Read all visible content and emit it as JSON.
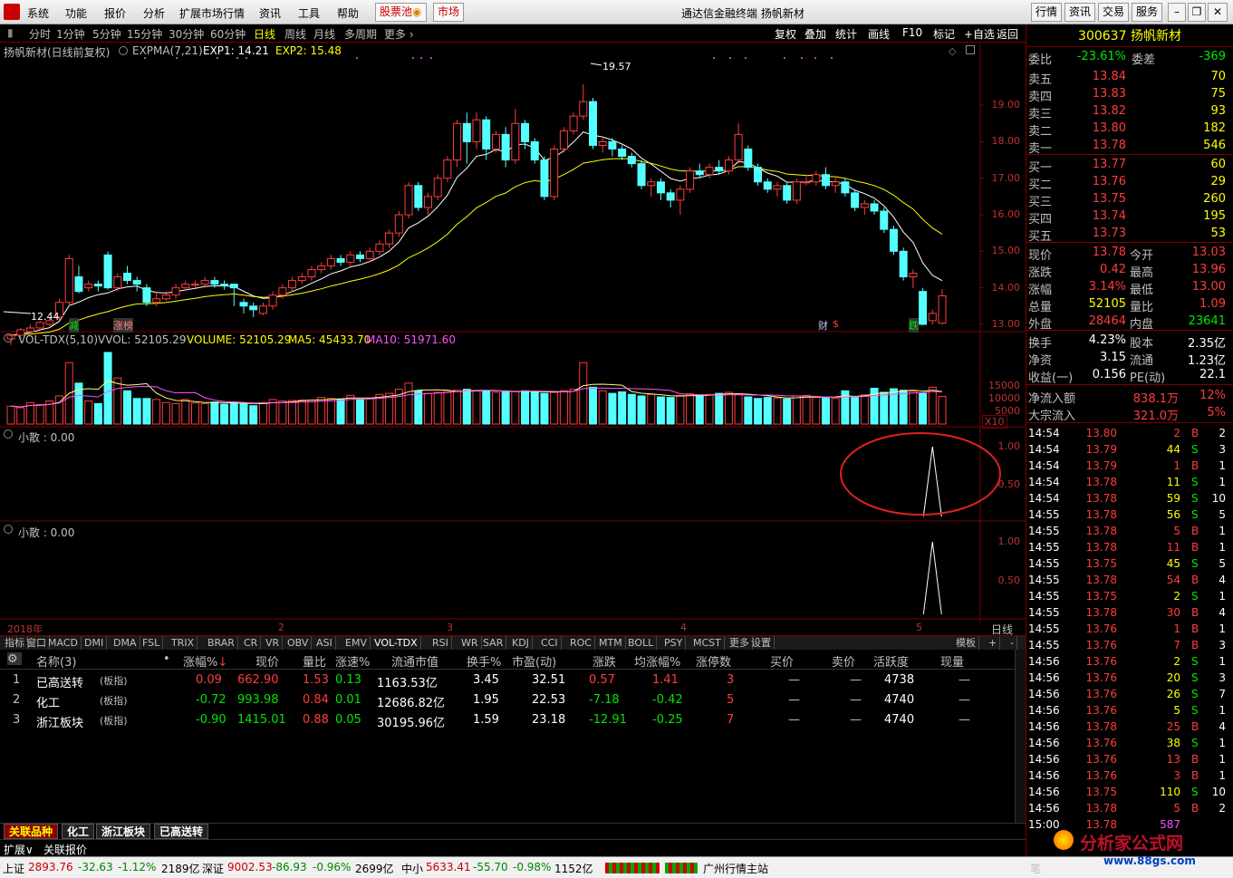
{
  "menu": {
    "items": [
      "系统",
      "功能",
      "报价",
      "分析",
      "扩展市场行情",
      "资讯",
      "工具",
      "帮助"
    ],
    "gupiaochi": "股票池",
    "shichang": "市场",
    "title": "通达信金融终端  扬帆新材",
    "right_btns": [
      "行情",
      "资讯",
      "交易",
      "服务"
    ]
  },
  "periods": {
    "items": [
      "分时",
      "1分钟",
      "5分钟",
      "15分钟",
      "30分钟",
      "60分钟",
      "日线",
      "周线",
      "月线",
      "多周期",
      "更多"
    ],
    "active": "日线"
  },
  "tools": [
    "复权",
    "叠加",
    "统计",
    "画线",
    "F10",
    "标记",
    "+自选",
    "返回"
  ],
  "chart_header": {
    "name": "扬帆新材(日线前复权)",
    "ind": "EXPMA(7,21)",
    "exp1": "EXP1: 14.21",
    "exp2": "EXP2: 15.48"
  },
  "price_axis": [
    "19.00",
    "18.00",
    "17.00",
    "16.00",
    "15.00",
    "14.00",
    "13.00"
  ],
  "annotations": {
    "high": "19.57",
    "low": "12.44",
    "tags": [
      "减",
      "涨榜",
      "财",
      "跌"
    ]
  },
  "vol_header": {
    "name": "VOL-TDX(5,10)",
    "vvol": "VVOL: 52105.29",
    "volume": "VOLUME: 52105.29",
    "ma5": "MA5: 45433.70",
    "ma10": "MA10: 51971.60"
  },
  "vol_axis": [
    "15000",
    "10000",
    "5000"
  ],
  "vol_unit": "X10",
  "sub1": {
    "title": "小散 : 0.00",
    "axis": [
      "1.00",
      "0.50"
    ]
  },
  "sub2": {
    "title": "小散 : 0.00",
    "axis": [
      "1.00",
      "0.50"
    ]
  },
  "time_axis": {
    "labels": [
      "2018年",
      "2",
      "3",
      "4",
      "5"
    ],
    "period": "日线"
  },
  "ind_tabs": [
    "指标",
    "窗口",
    "MACD",
    "DMI",
    "DMA",
    "FSL",
    "TRIX",
    "BRAR",
    "CR",
    "VR",
    "OBV",
    "ASI",
    "EMV",
    "VOL-TDX",
    "RSI",
    "WR",
    "SAR",
    "KDJ",
    "CCI",
    "ROC",
    "MTM",
    "BOLL",
    "PSY",
    "MCST",
    "更多",
    "设置"
  ],
  "ind_tabs_right": [
    "模板",
    "+",
    "-"
  ],
  "table": {
    "headers": [
      "名称(3)",
      "•",
      "涨幅%",
      "现价",
      "量比",
      "涨速%",
      "流通市值",
      "换手%",
      "市盈(动)",
      "涨跌",
      "均涨幅%",
      "涨停数",
      "买价",
      "卖价",
      "活跃度",
      "现量"
    ],
    "rows": [
      {
        "idx": "1",
        "name": "已高送转",
        "type": "(板指)",
        "chg": "0.09",
        "price": "662.90",
        "lb": "1.53",
        "speed": "0.13",
        "mv": "1163.53亿",
        "hs": "3.45",
        "pe": "32.51",
        "zd": "0.57",
        "avg": "1.41",
        "zt": "3",
        "buy": "—",
        "sell": "—",
        "act": "4738",
        "cur": "—"
      },
      {
        "idx": "2",
        "name": "化工",
        "type": "(板指)",
        "chg": "-0.72",
        "price": "993.98",
        "lb": "0.84",
        "speed": "0.01",
        "mv": "12686.82亿",
        "hs": "1.95",
        "pe": "22.53",
        "zd": "-7.18",
        "avg": "-0.42",
        "zt": "5",
        "buy": "—",
        "sell": "—",
        "act": "4740",
        "cur": "—"
      },
      {
        "idx": "3",
        "name": "浙江板块",
        "type": "(板指)",
        "chg": "-0.90",
        "price": "1415.01",
        "lb": "0.88",
        "speed": "0.05",
        "mv": "30195.96亿",
        "hs": "1.59",
        "pe": "23.18",
        "zd": "-12.91",
        "avg": "-0.25",
        "zt": "7",
        "buy": "—",
        "sell": "—",
        "act": "4740",
        "cur": "—"
      }
    ]
  },
  "bottom_tabs": [
    "关联品种",
    "化工",
    "浙江板块",
    "已高送转"
  ],
  "ext_tabs": [
    "扩展∨",
    "关联报价"
  ],
  "quote": {
    "code_name": "300637 扬帆新材",
    "weibi_label": "委比",
    "weibi": "-23.61%",
    "weicha_label": "委差",
    "weicha": "-369",
    "sells": [
      {
        "l": "卖五",
        "p": "13.84",
        "v": "70"
      },
      {
        "l": "卖四",
        "p": "13.83",
        "v": "75"
      },
      {
        "l": "卖三",
        "p": "13.82",
        "v": "93"
      },
      {
        "l": "卖二",
        "p": "13.80",
        "v": "182"
      },
      {
        "l": "卖一",
        "p": "13.78",
        "v": "546"
      }
    ],
    "buys": [
      {
        "l": "买一",
        "p": "13.77",
        "v": "60"
      },
      {
        "l": "买二",
        "p": "13.76",
        "v": "29"
      },
      {
        "l": "买三",
        "p": "13.75",
        "v": "260"
      },
      {
        "l": "买四",
        "p": "13.74",
        "v": "195"
      },
      {
        "l": "买五",
        "p": "13.73",
        "v": "53"
      }
    ],
    "stats": [
      {
        "a": "现价",
        "av": "13.78",
        "b": "今开",
        "bv": "13.03"
      },
      {
        "a": "涨跌",
        "av": "0.42",
        "b": "最高",
        "bv": "13.96"
      },
      {
        "a": "涨幅",
        "av": "3.14%",
        "b": "最低",
        "bv": "13.00"
      },
      {
        "a": "总量",
        "av": "52105",
        "b": "量比",
        "bv": "1.09"
      },
      {
        "a": "外盘",
        "av": "28464",
        "b": "内盘",
        "bv": "23641"
      }
    ],
    "stats2": [
      {
        "a": "换手",
        "av": "4.23%",
        "b": "股本",
        "bv": "2.35亿"
      },
      {
        "a": "净资",
        "av": "3.15",
        "b": "流通",
        "bv": "1.23亿"
      },
      {
        "a": "收益(一)",
        "av": "0.156",
        "b": "PE(动)",
        "bv": "22.1"
      }
    ],
    "flows": [
      {
        "l": "净流入额",
        "v": "838.1万",
        "p": "12%"
      },
      {
        "l": "大宗流入",
        "v": "321.0万",
        "p": "5%"
      }
    ]
  },
  "ticks": [
    [
      "14:54",
      "13.80",
      "2",
      "B",
      "2"
    ],
    [
      "14:54",
      "13.79",
      "44",
      "S",
      "3"
    ],
    [
      "14:54",
      "13.79",
      "1",
      "B",
      "1"
    ],
    [
      "14:54",
      "13.78",
      "11",
      "S",
      "1"
    ],
    [
      "14:54",
      "13.78",
      "59",
      "S",
      "10"
    ],
    [
      "14:55",
      "13.78",
      "56",
      "S",
      "5"
    ],
    [
      "14:55",
      "13.78",
      "5",
      "B",
      "1"
    ],
    [
      "14:55",
      "13.78",
      "11",
      "B",
      "1"
    ],
    [
      "14:55",
      "13.75",
      "45",
      "S",
      "5"
    ],
    [
      "14:55",
      "13.78",
      "54",
      "B",
      "4"
    ],
    [
      "14:55",
      "13.75",
      "2",
      "S",
      "1"
    ],
    [
      "14:55",
      "13.78",
      "30",
      "B",
      "4"
    ],
    [
      "14:55",
      "13.76",
      "1",
      "B",
      "1"
    ],
    [
      "14:55",
      "13.76",
      "7",
      "B",
      "3"
    ],
    [
      "14:56",
      "13.76",
      "2",
      "S",
      "1"
    ],
    [
      "14:56",
      "13.76",
      "20",
      "S",
      "3"
    ],
    [
      "14:56",
      "13.76",
      "26",
      "S",
      "7"
    ],
    [
      "14:56",
      "13.76",
      "5",
      "S",
      "1"
    ],
    [
      "14:56",
      "13.78",
      "25",
      "B",
      "4"
    ],
    [
      "14:56",
      "13.76",
      "38",
      "S",
      "1"
    ],
    [
      "14:56",
      "13.76",
      "13",
      "B",
      "1"
    ],
    [
      "14:56",
      "13.76",
      "3",
      "B",
      "1"
    ],
    [
      "14:56",
      "13.75",
      "110",
      "S",
      "10"
    ],
    [
      "14:56",
      "13.78",
      "5",
      "B",
      "2"
    ],
    [
      "15:00",
      "13.78",
      "587",
      "",
      ""
    ]
  ],
  "status": {
    "sh_label": "上证",
    "sh": "2893.76",
    "sh_chg": "-32.63",
    "sh_pct": "-1.12%",
    "sh_amt": "2189亿",
    "sz_label": "深证",
    "sz": "9002.53",
    "sz_chg": "-86.93",
    "sz_pct": "-0.96%",
    "sz_amt": "2699亿",
    "zx_label": "中小",
    "zx": "5633.41",
    "zx_chg": "-55.70",
    "zx_pct": "-0.98%",
    "zx_amt": "1152亿",
    "server": "广州行情主站",
    "watermark": "分析家公式网",
    "watermark_url": "www.88gs.com",
    "bi": "笔"
  },
  "candles": [
    [
      12.6,
      12.7,
      12.44,
      12.75
    ],
    [
      12.7,
      12.85,
      12.6,
      12.9
    ],
    [
      12.8,
      12.9,
      12.75,
      13.0
    ],
    [
      12.9,
      13.05,
      12.85,
      13.1
    ],
    [
      13.0,
      13.1,
      12.95,
      13.2
    ],
    [
      13.2,
      13.6,
      13.1,
      13.7
    ],
    [
      13.6,
      14.8,
      13.5,
      14.9
    ],
    [
      14.3,
      13.9,
      13.85,
      14.6
    ],
    [
      14.0,
      14.1,
      13.9,
      14.2
    ],
    [
      14.1,
      14.05,
      13.9,
      14.2
    ],
    [
      14.9,
      14.0,
      13.95,
      15.0
    ],
    [
      14.0,
      14.3,
      13.9,
      14.4
    ],
    [
      14.4,
      14.2,
      14.1,
      14.6
    ],
    [
      14.2,
      14.1,
      13.9,
      14.3
    ],
    [
      14.0,
      13.6,
      13.5,
      14.1
    ],
    [
      13.6,
      13.7,
      13.5,
      13.9
    ],
    [
      13.7,
      13.8,
      13.65,
      13.9
    ],
    [
      13.8,
      14.0,
      13.7,
      14.1
    ],
    [
      14.0,
      14.1,
      13.9,
      14.2
    ],
    [
      14.1,
      14.1,
      14.0,
      14.2
    ],
    [
      14.1,
      14.2,
      14.0,
      14.3
    ],
    [
      14.2,
      14.1,
      14.0,
      14.3
    ],
    [
      14.1,
      14.05,
      13.95,
      14.2
    ],
    [
      14.1,
      14.0,
      13.5,
      14.1
    ],
    [
      13.6,
      13.5,
      13.3,
      13.7
    ],
    [
      13.5,
      13.4,
      13.2,
      13.6
    ],
    [
      13.3,
      13.5,
      13.25,
      13.6
    ],
    [
      13.5,
      13.8,
      13.4,
      13.9
    ],
    [
      13.8,
      14.0,
      13.7,
      14.1
    ],
    [
      14.0,
      14.2,
      13.9,
      14.3
    ],
    [
      14.2,
      14.3,
      14.1,
      14.4
    ],
    [
      14.3,
      14.5,
      14.2,
      14.6
    ],
    [
      14.5,
      14.6,
      14.4,
      14.7
    ],
    [
      14.6,
      14.8,
      14.5,
      14.9
    ],
    [
      14.8,
      14.7,
      14.6,
      14.9
    ],
    [
      14.7,
      14.9,
      14.6,
      15.0
    ],
    [
      14.9,
      14.8,
      14.7,
      15.0
    ],
    [
      14.8,
      15.0,
      14.7,
      15.1
    ],
    [
      15.0,
      15.2,
      14.9,
      15.3
    ],
    [
      15.2,
      15.5,
      15.1,
      15.6
    ],
    [
      15.5,
      16.0,
      15.4,
      16.1
    ],
    [
      16.0,
      16.8,
      15.9,
      16.9
    ],
    [
      16.8,
      16.2,
      16.1,
      16.9
    ],
    [
      16.2,
      16.5,
      16.0,
      16.6
    ],
    [
      16.5,
      17.0,
      16.4,
      17.1
    ],
    [
      17.0,
      17.5,
      16.9,
      17.6
    ],
    [
      17.5,
      18.5,
      17.3,
      18.6
    ],
    [
      18.5,
      18.0,
      17.4,
      18.8
    ],
    [
      18.0,
      18.6,
      17.8,
      18.8
    ],
    [
      18.6,
      17.8,
      17.5,
      18.7
    ],
    [
      17.8,
      18.2,
      17.7,
      18.3
    ],
    [
      18.2,
      17.5,
      17.3,
      18.4
    ],
    [
      17.5,
      18.5,
      17.4,
      18.9
    ],
    [
      18.5,
      18.0,
      17.8,
      18.6
    ],
    [
      18.0,
      17.5,
      17.4,
      18.1
    ],
    [
      17.5,
      16.5,
      16.4,
      17.6
    ],
    [
      16.5,
      17.8,
      16.4,
      17.9
    ],
    [
      17.8,
      18.3,
      17.7,
      18.4
    ],
    [
      18.3,
      18.7,
      18.2,
      18.8
    ],
    [
      18.7,
      19.1,
      18.6,
      19.57
    ],
    [
      19.1,
      17.9,
      17.8,
      19.2
    ],
    [
      17.9,
      18.0,
      17.7,
      18.1
    ],
    [
      18.0,
      17.8,
      17.6,
      18.1
    ],
    [
      17.8,
      17.6,
      17.5,
      17.9
    ],
    [
      17.6,
      17.4,
      17.3,
      17.7
    ],
    [
      17.4,
      16.8,
      16.7,
      17.5
    ],
    [
      16.8,
      16.9,
      16.5,
      17.0
    ],
    [
      16.9,
      16.6,
      16.4,
      17.0
    ],
    [
      16.6,
      16.4,
      16.2,
      16.7
    ],
    [
      16.4,
      16.7,
      16.0,
      16.8
    ],
    [
      16.7,
      17.2,
      16.6,
      17.3
    ],
    [
      17.2,
      17.1,
      17.0,
      17.4
    ],
    [
      17.1,
      17.3,
      17.0,
      17.4
    ],
    [
      17.3,
      17.2,
      17.1,
      17.5
    ],
    [
      17.2,
      17.5,
      17.1,
      17.6
    ],
    [
      17.5,
      18.2,
      17.4,
      18.5
    ],
    [
      17.8,
      17.3,
      17.2,
      17.9
    ],
    [
      17.3,
      16.9,
      16.8,
      17.4
    ],
    [
      16.9,
      16.7,
      16.6,
      17.0
    ],
    [
      16.7,
      16.8,
      16.5,
      16.9
    ],
    [
      16.8,
      16.4,
      16.3,
      16.9
    ],
    [
      16.4,
      16.9,
      16.3,
      17.0
    ],
    [
      16.9,
      16.9,
      16.8,
      17.1
    ],
    [
      16.9,
      17.1,
      16.8,
      17.2
    ],
    [
      17.1,
      16.8,
      16.7,
      17.3
    ],
    [
      16.8,
      16.9,
      16.6,
      17.0
    ],
    [
      16.9,
      16.6,
      16.5,
      17.0
    ],
    [
      16.6,
      16.2,
      16.1,
      16.7
    ],
    [
      16.2,
      16.3,
      16.0,
      16.4
    ],
    [
      16.3,
      16.1,
      16.0,
      16.4
    ],
    [
      16.1,
      15.6,
      15.5,
      16.2
    ],
    [
      15.6,
      15.0,
      14.9,
      15.7
    ],
    [
      15.0,
      14.3,
      14.2,
      15.1
    ],
    [
      14.3,
      14.4,
      14.0,
      14.5
    ],
    [
      13.9,
      13.0,
      12.98,
      14.0
    ],
    [
      13.1,
      13.3,
      13.0,
      13.4
    ],
    [
      13.03,
      13.78,
      13.0,
      13.96
    ]
  ],
  "volumes": [
    3500,
    3200,
    4200,
    3800,
    4500,
    5500,
    12000,
    8000,
    4500,
    4000,
    14000,
    9000,
    6500,
    5000,
    5000,
    4800,
    4200,
    4000,
    4800,
    4100,
    4000,
    4300,
    3900,
    4200,
    4000,
    3600,
    4200,
    4800,
    4500,
    4600,
    4700,
    4700,
    5200,
    5000,
    4900,
    5600,
    4800,
    5000,
    5800,
    6000,
    6800,
    8000,
    6500,
    6000,
    6200,
    6400,
    6600,
    6800,
    6500,
    6500,
    6200,
    6400,
    6300,
    6500,
    6300,
    6000,
    6200,
    6500,
    6800,
    12000,
    7200,
    6500,
    6000,
    6300,
    5800,
    5500,
    5800,
    5300,
    5200,
    5600,
    5900,
    5700,
    5800,
    6000,
    6200,
    5900,
    5300,
    5000,
    5200,
    5100,
    4900,
    5500,
    5600,
    5300,
    5100,
    5000,
    6500,
    5200,
    5700,
    7000,
    6200,
    6900,
    6600,
    6400,
    6000,
    7200,
    5400
  ]
}
